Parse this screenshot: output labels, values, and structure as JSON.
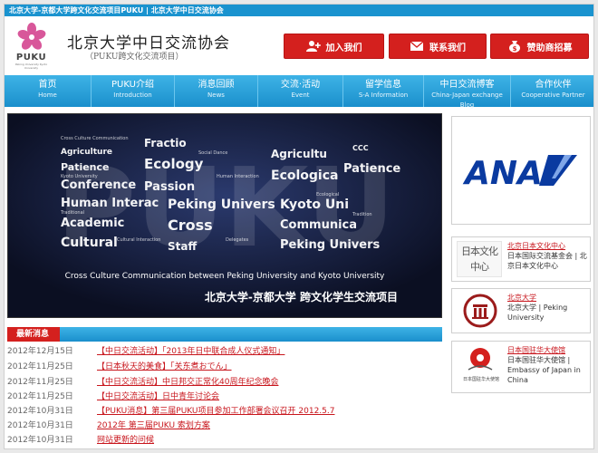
{
  "topbar": {
    "text": "北京大学-京都大学跨文化交流项目PUKU | 北京大学中日交流协会"
  },
  "header": {
    "logo_text": "PUKU",
    "logo_sub": "Peking University Kyoto University",
    "title": "北京大学中日交流协会",
    "subtitle": "（PUKU跨文化交流项目）",
    "buttons": [
      {
        "label": "加入我们",
        "icon": "user-add-icon"
      },
      {
        "label": "联系我们",
        "icon": "mail-icon"
      },
      {
        "label": "赞助商招募",
        "icon": "money-bag-icon"
      }
    ]
  },
  "nav": [
    {
      "cn": "首页",
      "en": "Home"
    },
    {
      "cn": "PUKU介绍",
      "en": "Introduction"
    },
    {
      "cn": "消息回顾",
      "en": "News"
    },
    {
      "cn": "交流·活动",
      "en": "Event"
    },
    {
      "cn": "留学信息",
      "en": "S-A Information"
    },
    {
      "cn": "中日交流博客",
      "en": "China-Japan exchange Blog"
    },
    {
      "cn": "合作伙伴",
      "en": "Cooperative Partner"
    }
  ],
  "banner": {
    "big_text": "PUKU",
    "line1": "Cross Culture Communication between Peking University and Kyoto University",
    "line2": "北京大学-京都大学 跨文化学生交流项目"
  },
  "ads": {
    "ana_text": "ANA",
    "sponsors": [
      {
        "logo_text": "日本文化中心",
        "name": "北京日本文化中心",
        "desc": "日本国际交流基金会 | 北京日本文化中心"
      },
      {
        "logo_text": "北京大学",
        "name": "北京大学",
        "desc": "北京大学 | Peking University"
      },
      {
        "logo_text": "日本国驻华大使馆",
        "name": "日本国驻华大使馆",
        "desc": "日本国驻华大使馆 | Embassy of Japan in China"
      }
    ]
  },
  "news": {
    "title": "最新消息",
    "items": [
      {
        "date": "2012年12月15日",
        "text": "【中日交流活动】「2013年日中联合成人仪式通知」"
      },
      {
        "date": "2012年11月25日",
        "text": "【日本秋天的美食】「关东煮おでん」"
      },
      {
        "date": "2012年11月25日",
        "text": "【中日交流活动】中日邦交正常化40周年纪念晚会"
      },
      {
        "date": "2012年11月25日",
        "text": "【中日交流活动】日中青年讨论会"
      },
      {
        "date": "2012年10月31日",
        "text": "【PUKU消息】第三届PUKU项目参加工作部署会议召开 2012.5.7"
      },
      {
        "date": "2012年10月31日",
        "text": "2012年 第三届PUKU 索划方案"
      },
      {
        "date": "2012年10月31日",
        "text": "网站更新的问候"
      }
    ]
  },
  "colors": {
    "accent_blue": "#1a93cf",
    "brand_red": "#d4201e",
    "link_red": "#c8161d",
    "ana_blue": "#0a3aa0"
  }
}
